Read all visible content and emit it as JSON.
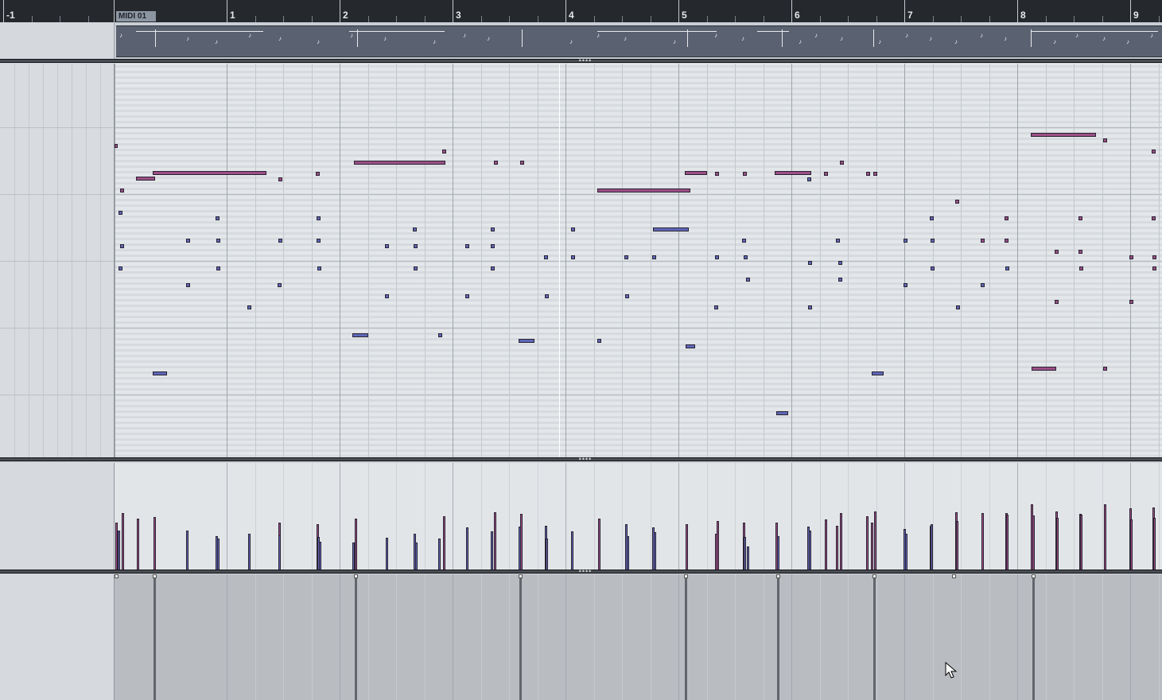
{
  "ruler": {
    "bars": [
      "-1",
      "1",
      "2",
      "3",
      "4",
      "5",
      "6",
      "7",
      "8",
      "9"
    ],
    "event_name": "MIDI 01"
  },
  "colors": {
    "ruler_bg": "#25282c",
    "note_purple": "#9c4f86",
    "note_blue": "#5d68b8",
    "grid_bg": "#e4e7ea",
    "controller_bg": "#b9bcc1"
  },
  "icons": {
    "splitter_grip": "••••",
    "cursor": "mouse-pointer-icon"
  }
}
